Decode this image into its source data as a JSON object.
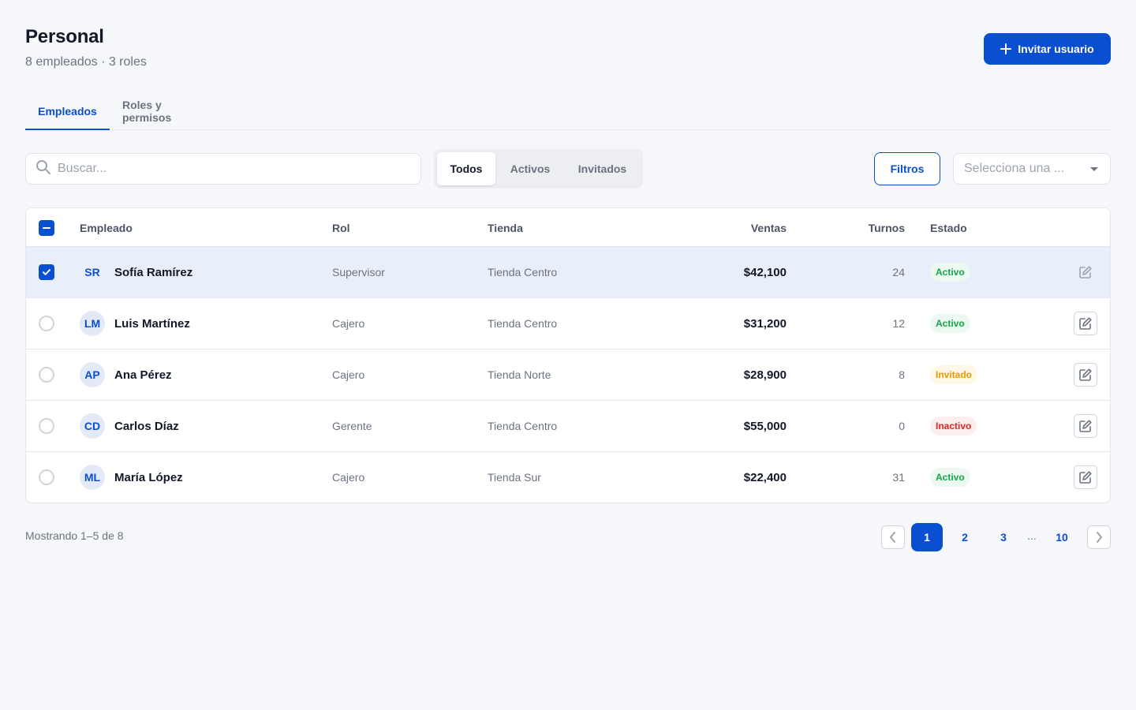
{
  "header": {
    "title": "Personal",
    "subtitle": "8 empleados · 3 roles",
    "invite_label": "Invitar usuario"
  },
  "tabs": [
    {
      "label": "Empleados",
      "active": true
    },
    {
      "label": "Roles y permisos",
      "active": false
    }
  ],
  "toolbar": {
    "search_placeholder": "Buscar...",
    "segments": [
      {
        "label": "Todos",
        "active": true
      },
      {
        "label": "Activos",
        "active": false
      },
      {
        "label": "Invitados",
        "active": false
      }
    ],
    "filters_label": "Filtros",
    "select_placeholder": "Selecciona una ..."
  },
  "table": {
    "columns": {
      "empleado": "Empleado",
      "rol": "Rol",
      "tienda": "Tienda",
      "ventas": "Ventas",
      "turnos": "Turnos",
      "estado": "Estado"
    },
    "rows": [
      {
        "initials": "SR",
        "name": "Sofía Ramírez",
        "rol": "Supervisor",
        "tienda": "Tienda Centro",
        "ventas": "$42,100",
        "turnos": "24",
        "estado": "Activo",
        "status_kind": "activo",
        "selected": true
      },
      {
        "initials": "LM",
        "name": "Luis Martínez",
        "rol": "Cajero",
        "tienda": "Tienda Centro",
        "ventas": "$31,200",
        "turnos": "12",
        "estado": "Activo",
        "status_kind": "activo",
        "selected": false
      },
      {
        "initials": "AP",
        "name": "Ana Pérez",
        "rol": "Cajero",
        "tienda": "Tienda Norte",
        "ventas": "$28,900",
        "turnos": "8",
        "estado": "Invitado",
        "status_kind": "invitado",
        "selected": false
      },
      {
        "initials": "CD",
        "name": "Carlos Díaz",
        "rol": "Gerente",
        "tienda": "Tienda Centro",
        "ventas": "$55,000",
        "turnos": "0",
        "estado": "Inactivo",
        "status_kind": "inactivo",
        "selected": false
      },
      {
        "initials": "ML",
        "name": "María López",
        "rol": "Cajero",
        "tienda": "Tienda Sur",
        "ventas": "$22,400",
        "turnos": "31",
        "estado": "Activo",
        "status_kind": "activo",
        "selected": false
      }
    ]
  },
  "footer": {
    "showing": "Mostrando 1–5 de 8",
    "pages": [
      "1",
      "2",
      "3",
      "10"
    ],
    "ellipsis": "...",
    "current_page": "1"
  },
  "colors": {
    "primary": "#0b4fd1",
    "background": "#f6f7fb",
    "selected_row": "#e8eefa",
    "status_activo": "#16a34a",
    "status_invitado": "#e19a06",
    "status_inactivo": "#dc2626"
  },
  "icons": {
    "invite": "plus-icon",
    "search": "search-icon",
    "select": "chevron-down-icon",
    "edit": "edit-icon",
    "prev": "chevron-left-icon",
    "next": "chevron-right-icon",
    "select_all": "indeterminate-checkbox-icon",
    "row_selected": "check-icon"
  }
}
